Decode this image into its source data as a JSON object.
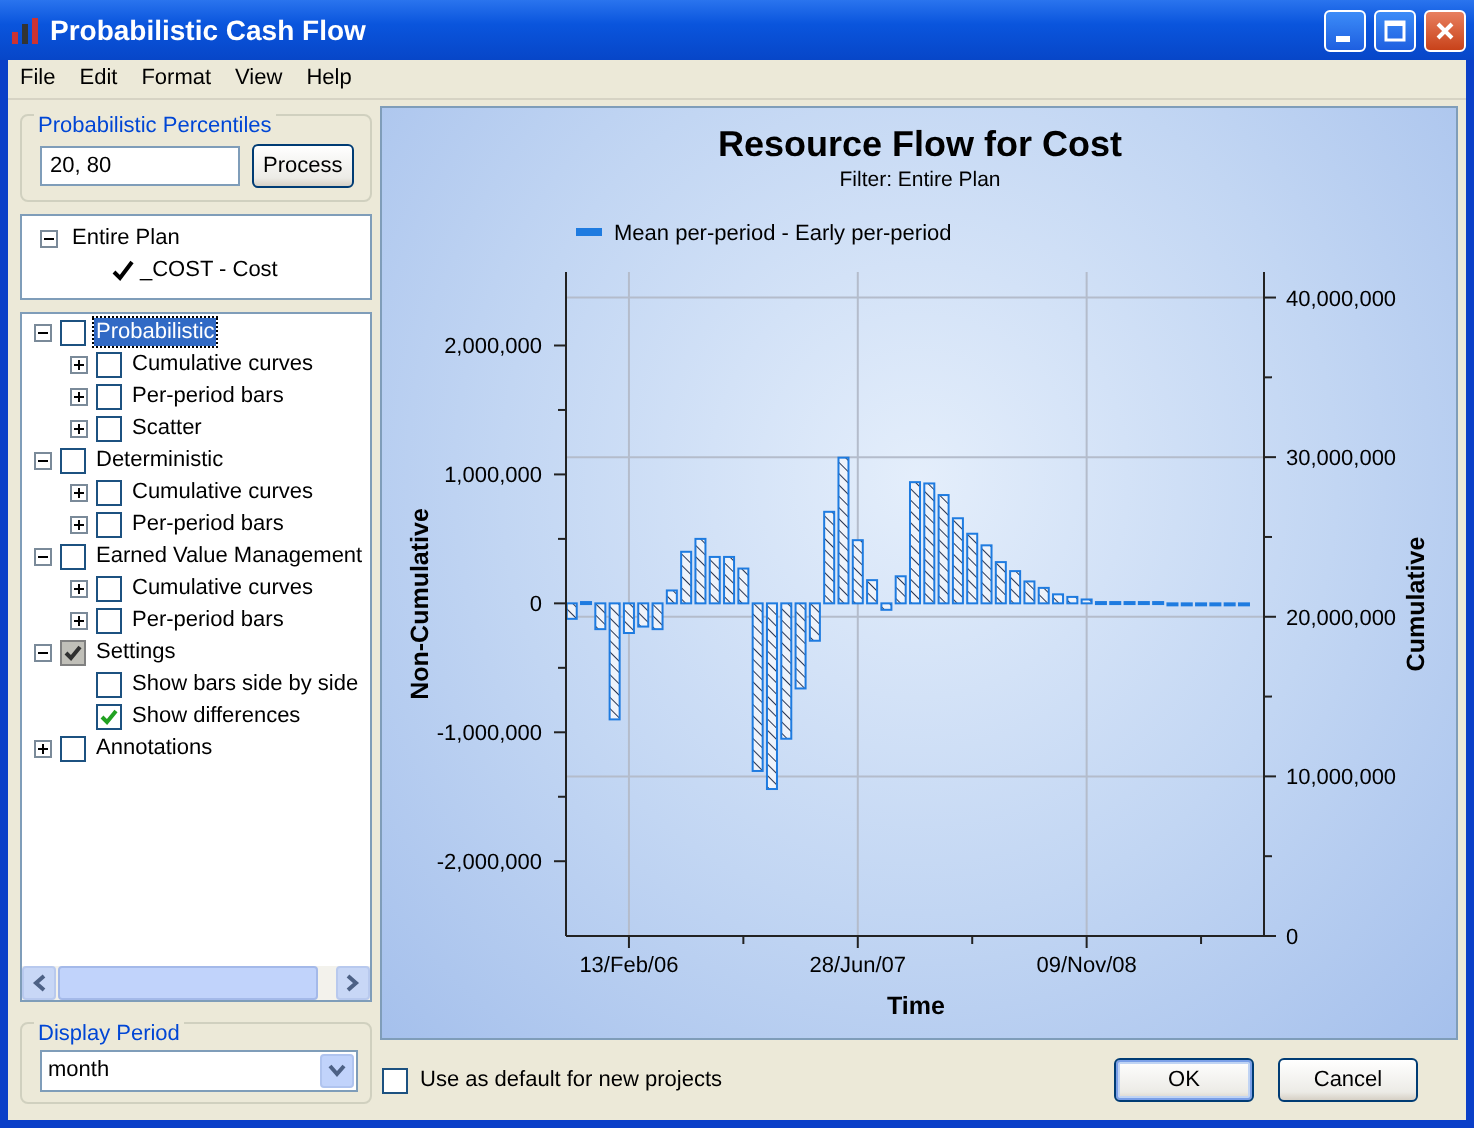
{
  "window": {
    "title": "Probabilistic Cash Flow"
  },
  "menu": [
    "File",
    "Edit",
    "Format",
    "View",
    "Help"
  ],
  "percentiles": {
    "label": "Probabilistic Percentiles",
    "value": "20, 80",
    "button": "Process"
  },
  "plan_tree": [
    {
      "label": "Entire Plan",
      "expanded": true,
      "children": [
        {
          "label": "_COST - Cost",
          "checked": true
        }
      ]
    }
  ],
  "options_tree": [
    {
      "label": "Probabilistic",
      "checked": false,
      "partial": false,
      "selected": true,
      "expanded": true,
      "children": [
        {
          "label": "Cumulative curves",
          "checked": false,
          "partial": false,
          "selected": false,
          "expanded": false
        },
        {
          "label": "Per-period bars",
          "checked": false,
          "partial": false,
          "selected": false,
          "expanded": false
        },
        {
          "label": "Scatter",
          "checked": false,
          "partial": false,
          "selected": false,
          "expanded": false
        }
      ]
    },
    {
      "label": "Deterministic",
      "checked": false,
      "partial": false,
      "selected": false,
      "expanded": true,
      "children": [
        {
          "label": "Cumulative curves",
          "checked": false,
          "partial": false,
          "selected": false,
          "expanded": false
        },
        {
          "label": "Per-period bars",
          "checked": false,
          "partial": false,
          "selected": false,
          "expanded": false
        }
      ]
    },
    {
      "label": "Earned Value Management",
      "checked": false,
      "partial": false,
      "selected": false,
      "expanded": true,
      "children": [
        {
          "label": "Cumulative curves",
          "checked": false,
          "partial": false,
          "selected": false,
          "expanded": false
        },
        {
          "label": "Per-period bars",
          "checked": false,
          "partial": false,
          "selected": false,
          "expanded": false
        }
      ]
    },
    {
      "label": "Settings",
      "checked": true,
      "partial": true,
      "selected": false,
      "expanded": true,
      "children": [
        {
          "label": "Show bars side by side",
          "checked": false,
          "partial": false,
          "selected": false
        },
        {
          "label": "Show differences",
          "checked": true,
          "partial": false,
          "selected": false
        }
      ]
    },
    {
      "label": "Annotations",
      "checked": false,
      "partial": false,
      "selected": false,
      "expanded": false
    }
  ],
  "display_period": {
    "label": "Display Period",
    "value": "month"
  },
  "chart": {
    "chart_data": {
      "type": "bar",
      "title": "Resource Flow for Cost",
      "subtitle": "Filter: Entire Plan",
      "xlabel": "Time",
      "ylabel": "Non-Cumulative",
      "y2label": "Cumulative",
      "categories": [
        null,
        null,
        null,
        null,
        "13/Feb/06",
        null,
        null,
        null,
        null,
        null,
        null,
        null,
        null,
        null,
        null,
        null,
        null,
        null,
        null,
        null,
        "28/Jun/07",
        null,
        null,
        null,
        null,
        null,
        null,
        null,
        null,
        null,
        null,
        null,
        null,
        null,
        null,
        null,
        "09/Nov/08",
        null,
        null,
        null,
        null,
        null,
        null,
        null,
        null,
        null,
        null,
        null
      ],
      "series": [
        {
          "name": "Mean per-period - Early per-period",
          "color": "#1e7be0",
          "values": [
            -120000,
            10000,
            -200000,
            -900000,
            -230000,
            -180000,
            -200000,
            100000,
            400000,
            500000,
            360000,
            360000,
            270000,
            -1300000,
            -1440000,
            -1050000,
            -660000,
            -290000,
            710000,
            1130000,
            490000,
            180000,
            -50000,
            210000,
            940000,
            930000,
            840000,
            660000,
            540000,
            450000,
            320000,
            250000,
            170000,
            120000,
            70000,
            50000,
            30000,
            10000,
            10000,
            10000,
            10000,
            10000,
            0,
            0,
            0,
            0,
            0,
            0
          ]
        }
      ],
      "grid": true,
      "ylim": [
        -2580000,
        2570000
      ],
      "y2lim": [
        0,
        41600000
      ],
      "yticks": [
        {
          "value": -2000000,
          "label": "-2,000,000"
        },
        {
          "value": -1000000,
          "label": "-1,000,000"
        },
        {
          "value": 0,
          "label": "0"
        },
        {
          "value": 1000000,
          "label": "1,000,000"
        },
        {
          "value": 2000000,
          "label": "2,000,000"
        }
      ],
      "y2ticks": [
        {
          "value": 0,
          "label": "0"
        },
        {
          "value": 10000000,
          "label": "10,000,000"
        },
        {
          "value": 20000000,
          "label": "20,000,000"
        },
        {
          "value": 30000000,
          "label": "30,000,000"
        },
        {
          "value": 40000000,
          "label": "40,000,000"
        }
      ]
    }
  },
  "default_checkbox": {
    "label": "Use as default for new projects",
    "checked": false
  },
  "buttons": [
    {
      "label": "OK",
      "default": true
    },
    {
      "label": "Cancel",
      "default": false
    }
  ]
}
